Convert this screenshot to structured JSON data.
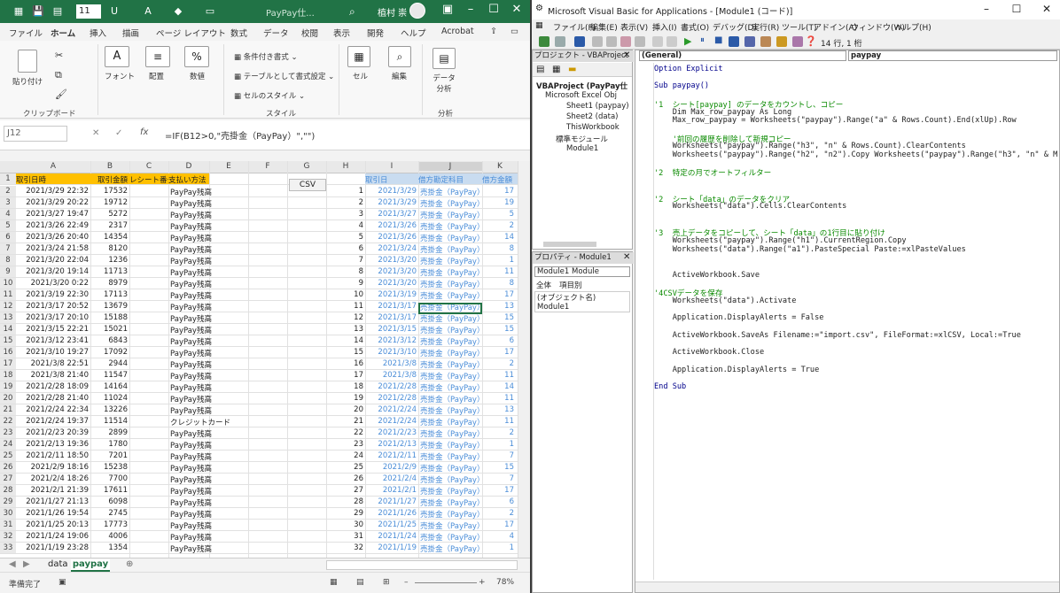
{
  "excel": {
    "font_size": "11",
    "doc_title": "PayPay仕...",
    "user_name": "植村 崇",
    "menu": [
      "ファイル",
      "ホーム",
      "挿入",
      "描画",
      "ページ レイアウト",
      "数式",
      "データ",
      "校閲",
      "表示",
      "開発",
      "ヘルプ",
      "Acrobat"
    ],
    "ribbon": {
      "paste": "貼り付け",
      "clipboard": "クリップボード",
      "font": "フォント",
      "alignment": "配置",
      "number": "数値",
      "conditional": "条件付き書式",
      "table_format": "テーブルとして書式設定",
      "cell_style": "セルのスタイル",
      "style_group": "スタイル",
      "cells": "セル",
      "edit": "編集",
      "data_analysis": "データ分析",
      "analysis_group": "分析"
    },
    "name_box": "J12",
    "formula": "=IF(B12>0,\"売掛金（PayPay）\",\"\")",
    "columns": [
      "A",
      "B",
      "C",
      "D",
      "E",
      "F",
      "G",
      "H",
      "I",
      "J",
      "K"
    ],
    "csv_button": "CSV",
    "header": {
      "a": "取引日時",
      "b": "取引金額",
      "c": "レシート番号",
      "d": "支払い方法",
      "i": "取引日",
      "j": "借方勘定科目",
      "k": "借方金額"
    },
    "rows": [
      [
        "2",
        "2021/3/29 22:32",
        "17532",
        "PayPay残高",
        "1",
        "2021/3/29",
        "売掛金（PayPay）",
        "17"
      ],
      [
        "3",
        "2021/3/29 20:22",
        "19712",
        "PayPay残高",
        "2",
        "2021/3/29",
        "売掛金（PayPay）",
        "19"
      ],
      [
        "4",
        "2021/3/27 19:47",
        "5272",
        "PayPay残高",
        "3",
        "2021/3/27",
        "売掛金（PayPay）",
        "5"
      ],
      [
        "5",
        "2021/3/26 22:49",
        "2317",
        "PayPay残高",
        "4",
        "2021/3/26",
        "売掛金（PayPay）",
        "2"
      ],
      [
        "6",
        "2021/3/26 20:40",
        "14354",
        "PayPay残高",
        "5",
        "2021/3/26",
        "売掛金（PayPay）",
        "14"
      ],
      [
        "7",
        "2021/3/24 21:58",
        "8120",
        "PayPay残高",
        "6",
        "2021/3/24",
        "売掛金（PayPay）",
        "8"
      ],
      [
        "8",
        "2021/3/20 22:04",
        "1236",
        "PayPay残高",
        "7",
        "2021/3/20",
        "売掛金（PayPay）",
        "1"
      ],
      [
        "9",
        "2021/3/20 19:14",
        "11713",
        "PayPay残高",
        "8",
        "2021/3/20",
        "売掛金（PayPay）",
        "11"
      ],
      [
        "10",
        "2021/3/20 0:22",
        "8979",
        "PayPay残高",
        "9",
        "2021/3/20",
        "売掛金（PayPay）",
        "8"
      ],
      [
        "11",
        "2021/3/19 22:30",
        "17113",
        "PayPay残高",
        "10",
        "2021/3/19",
        "売掛金（PayPay）",
        "17"
      ],
      [
        "12",
        "2021/3/17 20:52",
        "13679",
        "PayPay残高",
        "11",
        "2021/3/17",
        "売掛金（PayPay）",
        "13"
      ],
      [
        "13",
        "2021/3/17 20:10",
        "15188",
        "PayPay残高",
        "12",
        "2021/3/17",
        "売掛金（PayPay）",
        "15"
      ],
      [
        "14",
        "2021/3/15 22:21",
        "15021",
        "PayPay残高",
        "13",
        "2021/3/15",
        "売掛金（PayPay）",
        "15"
      ],
      [
        "15",
        "2021/3/12 23:41",
        "6843",
        "PayPay残高",
        "14",
        "2021/3/12",
        "売掛金（PayPay）",
        "6"
      ],
      [
        "16",
        "2021/3/10 19:27",
        "17092",
        "PayPay残高",
        "15",
        "2021/3/10",
        "売掛金（PayPay）",
        "17"
      ],
      [
        "17",
        "2021/3/8 22:51",
        "2944",
        "PayPay残高",
        "16",
        "2021/3/8",
        "売掛金（PayPay）",
        "2"
      ],
      [
        "18",
        "2021/3/8 21:40",
        "11547",
        "PayPay残高",
        "17",
        "2021/3/8",
        "売掛金（PayPay）",
        "11"
      ],
      [
        "19",
        "2021/2/28 18:09",
        "14164",
        "PayPay残高",
        "18",
        "2021/2/28",
        "売掛金（PayPay）",
        "14"
      ],
      [
        "20",
        "2021/2/28 21:40",
        "11024",
        "PayPay残高",
        "19",
        "2021/2/28",
        "売掛金（PayPay）",
        "11"
      ],
      [
        "21",
        "2021/2/24 22:34",
        "13226",
        "PayPay残高",
        "20",
        "2021/2/24",
        "売掛金（PayPay）",
        "13"
      ],
      [
        "22",
        "2021/2/24 19:37",
        "11514",
        "クレジットカード",
        "21",
        "2021/2/24",
        "売掛金（PayPay）",
        "11"
      ],
      [
        "23",
        "2021/2/23 20:39",
        "2899",
        "PayPay残高",
        "22",
        "2021/2/23",
        "売掛金（PayPay）",
        "2"
      ],
      [
        "24",
        "2021/2/13 19:36",
        "1780",
        "PayPay残高",
        "23",
        "2021/2/13",
        "売掛金（PayPay）",
        "1"
      ],
      [
        "25",
        "2021/2/11 18:50",
        "7201",
        "PayPay残高",
        "24",
        "2021/2/11",
        "売掛金（PayPay）",
        "7"
      ],
      [
        "26",
        "2021/2/9 18:16",
        "15238",
        "PayPay残高",
        "25",
        "2021/2/9",
        "売掛金（PayPay）",
        "15"
      ],
      [
        "27",
        "2021/2/4 18:26",
        "7700",
        "PayPay残高",
        "26",
        "2021/2/4",
        "売掛金（PayPay）",
        "7"
      ],
      [
        "28",
        "2021/2/1 21:39",
        "17611",
        "PayPay残高",
        "27",
        "2021/2/1",
        "売掛金（PayPay）",
        "17"
      ],
      [
        "29",
        "2021/1/27 21:13",
        "6098",
        "PayPay残高",
        "28",
        "2021/1/27",
        "売掛金（PayPay）",
        "6"
      ],
      [
        "30",
        "2021/1/26 19:54",
        "2745",
        "PayPay残高",
        "29",
        "2021/1/26",
        "売掛金（PayPay）",
        "2"
      ],
      [
        "31",
        "2021/1/25 20:13",
        "17773",
        "PayPay残高",
        "30",
        "2021/1/25",
        "売掛金（PayPay）",
        "17"
      ],
      [
        "32",
        "2021/1/24 19:06",
        "4006",
        "PayPay残高",
        "31",
        "2021/1/24",
        "売掛金（PayPay）",
        "4"
      ],
      [
        "33",
        "2021/1/19 23:28",
        "1354",
        "PayPay残高",
        "32",
        "2021/1/19",
        "売掛金（PayPay）",
        "1"
      ]
    ],
    "sheet_tabs": [
      "data",
      "paypay"
    ],
    "status": "準備完了",
    "zoom": "78%"
  },
  "vba": {
    "title": "Microsoft Visual Basic for Applications - [Module1 (コード)]",
    "menu": [
      "ファイル(F)",
      "編集(E)",
      "表示(V)",
      "挿入(I)",
      "書式(O)",
      "デバッグ(D)",
      "実行(R)",
      "ツール(T)",
      "アドイン(A)",
      "ウィンドウ(W)",
      "ヘルプ(H)"
    ],
    "position": "14 行, 1 桁",
    "project_title": "プロジェクト - VBAProject",
    "tree": [
      "VBAProject (PayPay仕",
      "Microsoft Excel Obj",
      "Sheet1 (paypay)",
      "Sheet2 (data)",
      "ThisWorkbook",
      "標準モジュール",
      "Module1"
    ],
    "props_title": "プロパティ - Module1",
    "props_combo": "Module1 Module",
    "props_tabs": [
      "全体",
      "項目別"
    ],
    "props_row": "(オブジェクト名) Module1",
    "combo_general": "(General)",
    "combo_proc": "paypay",
    "code": [
      {
        "t": "Option Explicit",
        "c": "kw"
      },
      {
        "t": "",
        "c": ""
      },
      {
        "t": "Sub paypay()",
        "c": "kw"
      },
      {
        "t": "",
        "c": ""
      },
      {
        "t": "'1  シート[paypay] のデータをカウントし、コピー",
        "c": "cm"
      },
      {
        "t": "    Dim Max_row_paypay As Long",
        "c": ""
      },
      {
        "t": "    Max_row_paypay = Worksheets(\"paypay\").Range(\"a\" & Rows.Count).End(xlUp).Row",
        "c": ""
      },
      {
        "t": "",
        "c": ""
      },
      {
        "t": "    '前回の履歴を削除して新規コピー",
        "c": "cm"
      },
      {
        "t": "    Worksheets(\"paypay\").Range(\"h3\", \"n\" & Rows.Count).ClearContents",
        "c": ""
      },
      {
        "t": "    Worksheets(\"paypay\").Range(\"h2\", \"n2\").Copy Worksheets(\"paypay\").Range(\"h3\", \"n\" & Max",
        "c": ""
      },
      {
        "t": "",
        "c": ""
      },
      {
        "t": "'2  特定の月でオートフィルター",
        "c": "cm"
      },
      {
        "t": "",
        "c": ""
      },
      {
        "t": "",
        "c": ""
      },
      {
        "t": "'2  シート「data」のデータをクリア",
        "c": "cm"
      },
      {
        "t": "    Worksheets(\"data\").Cells.ClearContents",
        "c": ""
      },
      {
        "t": "",
        "c": ""
      },
      {
        "t": "",
        "c": ""
      },
      {
        "t": "'3  売上データをコピーして、シート「data」の1行目に貼り付け",
        "c": "cm"
      },
      {
        "t": "    Worksheets(\"paypay\").Range(\"h1\").CurrentRegion.Copy",
        "c": ""
      },
      {
        "t": "    Worksheets(\"data\").Range(\"a1\").PasteSpecial Paste:=xlPasteValues",
        "c": ""
      },
      {
        "t": "",
        "c": ""
      },
      {
        "t": "",
        "c": ""
      },
      {
        "t": "    ActiveWorkbook.Save",
        "c": ""
      },
      {
        "t": "",
        "c": ""
      },
      {
        "t": "'4CSVデータを保存",
        "c": "cm"
      },
      {
        "t": "    Worksheets(\"data\").Activate",
        "c": ""
      },
      {
        "t": "",
        "c": ""
      },
      {
        "t": "    Application.DisplayAlerts = False",
        "c": ""
      },
      {
        "t": "",
        "c": ""
      },
      {
        "t": "    ActiveWorkbook.SaveAs Filename:=\"import.csv\", FileFormat:=xlCSV, Local:=True",
        "c": ""
      },
      {
        "t": "",
        "c": ""
      },
      {
        "t": "    ActiveWorkbook.Close",
        "c": ""
      },
      {
        "t": "",
        "c": ""
      },
      {
        "t": "    Application.DisplayAlerts = True",
        "c": ""
      },
      {
        "t": "",
        "c": ""
      },
      {
        "t": "End Sub",
        "c": "kw"
      }
    ]
  }
}
